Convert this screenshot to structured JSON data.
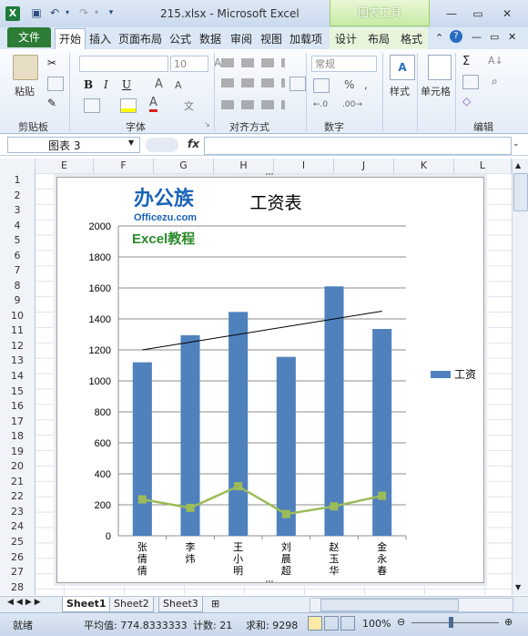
{
  "window": {
    "file_name": "215.xlsx",
    "app_name": "Microsoft Excel",
    "title": "215.xlsx  -  Microsoft Excel",
    "context_tool": "图表工具"
  },
  "tabs": {
    "file": "文件",
    "items": [
      "开始",
      "插入",
      "页面布局",
      "公式",
      "数据",
      "审阅",
      "视图",
      "加载项",
      "设计",
      "布局",
      "格式"
    ]
  },
  "ribbon": {
    "clipboard": {
      "paste": "粘贴",
      "label": "剪贴板"
    },
    "font": {
      "size": "10",
      "bold": "B",
      "italic": "I",
      "underline": "U",
      "label": "字体",
      "glyph": "A"
    },
    "alignment": {
      "label": "对齐方式"
    },
    "number": {
      "format": "常规",
      "percent": "%",
      "comma": ",",
      "label": "数字"
    },
    "styles": {
      "label": "样式"
    },
    "cells": {
      "label": "单元格"
    },
    "editing": {
      "sigma": "Σ",
      "label": "编辑"
    }
  },
  "formula_bar": {
    "name_box": "图表 3",
    "fx": "fx",
    "value": ""
  },
  "columns": [
    "E",
    "F",
    "G",
    "H",
    "I",
    "J",
    "K",
    "L"
  ],
  "rows": [
    "1",
    "2",
    "3",
    "4",
    "5",
    "6",
    "7",
    "8",
    "9",
    "10",
    "11",
    "12",
    "13",
    "14",
    "15",
    "16",
    "17",
    "18",
    "19",
    "20",
    "21",
    "22",
    "23",
    "24",
    "25",
    "26",
    "27",
    "28"
  ],
  "watermark": {
    "logo_text": "办公族",
    "logo_url": "Officezu.com",
    "subtitle": "Excel教程"
  },
  "chart_data": {
    "type": "bar",
    "title": "工资表",
    "categories": [
      "张倩倩",
      "李炜",
      "王小明",
      "刘晨超",
      "赵玉华",
      "金永春"
    ],
    "series": [
      {
        "name": "工资",
        "type": "bar",
        "values": [
          1120,
          1295,
          1445,
          1155,
          1610,
          1335
        ],
        "color": "#4f81bd"
      },
      {
        "name": "",
        "type": "line",
        "values": [
          235,
          180,
          320,
          140,
          190,
          258
        ],
        "color": "#9bbb59"
      }
    ],
    "trendline": {
      "start": 1200,
      "end": 1450,
      "color": "#000000"
    },
    "ylim": [
      0,
      2000
    ],
    "yticks": [
      0,
      200,
      400,
      600,
      800,
      1000,
      1200,
      1400,
      1600,
      1800,
      2000
    ],
    "legend": {
      "position": "right",
      "label": "工资"
    },
    "grid": true
  },
  "sheets": [
    "Sheet1",
    "Sheet2",
    "Sheet3"
  ],
  "status": {
    "ready": "就绪",
    "average": "平均值: 774.8333333",
    "count": "计数: 21",
    "sum": "求和: 9298",
    "zoom": "100%"
  }
}
